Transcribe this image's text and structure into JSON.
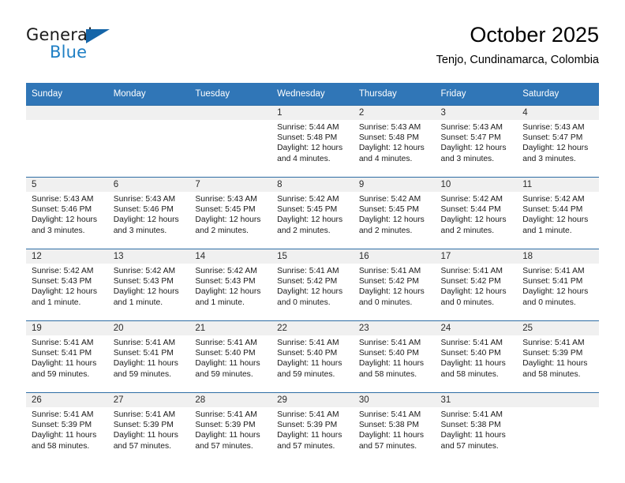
{
  "brand": {
    "word1": "General",
    "word2": "Blue",
    "triangle_color": "#1565a8",
    "blue_color": "#1f7fc4"
  },
  "header": {
    "title": "October 2025",
    "subtitle": "Tenjo, Cundinamarca, Colombia"
  },
  "theme": {
    "header_row_bg": "#3076b7",
    "cell_border": "#2e6da4",
    "day_band_bg": "#f0f0f0"
  },
  "weekday_headers": [
    "Sunday",
    "Monday",
    "Tuesday",
    "Wednesday",
    "Thursday",
    "Friday",
    "Saturday"
  ],
  "weeks": [
    [
      {
        "empty": true
      },
      {
        "empty": true
      },
      {
        "empty": true
      },
      {
        "day": "1",
        "sunrise": "Sunrise: 5:44 AM",
        "sunset": "Sunset: 5:48 PM",
        "daylight1": "Daylight: 12 hours",
        "daylight2": "and 4 minutes."
      },
      {
        "day": "2",
        "sunrise": "Sunrise: 5:43 AM",
        "sunset": "Sunset: 5:48 PM",
        "daylight1": "Daylight: 12 hours",
        "daylight2": "and 4 minutes."
      },
      {
        "day": "3",
        "sunrise": "Sunrise: 5:43 AM",
        "sunset": "Sunset: 5:47 PM",
        "daylight1": "Daylight: 12 hours",
        "daylight2": "and 3 minutes."
      },
      {
        "day": "4",
        "sunrise": "Sunrise: 5:43 AM",
        "sunset": "Sunset: 5:47 PM",
        "daylight1": "Daylight: 12 hours",
        "daylight2": "and 3 minutes."
      }
    ],
    [
      {
        "day": "5",
        "sunrise": "Sunrise: 5:43 AM",
        "sunset": "Sunset: 5:46 PM",
        "daylight1": "Daylight: 12 hours",
        "daylight2": "and 3 minutes."
      },
      {
        "day": "6",
        "sunrise": "Sunrise: 5:43 AM",
        "sunset": "Sunset: 5:46 PM",
        "daylight1": "Daylight: 12 hours",
        "daylight2": "and 3 minutes."
      },
      {
        "day": "7",
        "sunrise": "Sunrise: 5:43 AM",
        "sunset": "Sunset: 5:45 PM",
        "daylight1": "Daylight: 12 hours",
        "daylight2": "and 2 minutes."
      },
      {
        "day": "8",
        "sunrise": "Sunrise: 5:42 AM",
        "sunset": "Sunset: 5:45 PM",
        "daylight1": "Daylight: 12 hours",
        "daylight2": "and 2 minutes."
      },
      {
        "day": "9",
        "sunrise": "Sunrise: 5:42 AM",
        "sunset": "Sunset: 5:45 PM",
        "daylight1": "Daylight: 12 hours",
        "daylight2": "and 2 minutes."
      },
      {
        "day": "10",
        "sunrise": "Sunrise: 5:42 AM",
        "sunset": "Sunset: 5:44 PM",
        "daylight1": "Daylight: 12 hours",
        "daylight2": "and 2 minutes."
      },
      {
        "day": "11",
        "sunrise": "Sunrise: 5:42 AM",
        "sunset": "Sunset: 5:44 PM",
        "daylight1": "Daylight: 12 hours",
        "daylight2": "and 1 minute."
      }
    ],
    [
      {
        "day": "12",
        "sunrise": "Sunrise: 5:42 AM",
        "sunset": "Sunset: 5:43 PM",
        "daylight1": "Daylight: 12 hours",
        "daylight2": "and 1 minute."
      },
      {
        "day": "13",
        "sunrise": "Sunrise: 5:42 AM",
        "sunset": "Sunset: 5:43 PM",
        "daylight1": "Daylight: 12 hours",
        "daylight2": "and 1 minute."
      },
      {
        "day": "14",
        "sunrise": "Sunrise: 5:42 AM",
        "sunset": "Sunset: 5:43 PM",
        "daylight1": "Daylight: 12 hours",
        "daylight2": "and 1 minute."
      },
      {
        "day": "15",
        "sunrise": "Sunrise: 5:41 AM",
        "sunset": "Sunset: 5:42 PM",
        "daylight1": "Daylight: 12 hours",
        "daylight2": "and 0 minutes."
      },
      {
        "day": "16",
        "sunrise": "Sunrise: 5:41 AM",
        "sunset": "Sunset: 5:42 PM",
        "daylight1": "Daylight: 12 hours",
        "daylight2": "and 0 minutes."
      },
      {
        "day": "17",
        "sunrise": "Sunrise: 5:41 AM",
        "sunset": "Sunset: 5:42 PM",
        "daylight1": "Daylight: 12 hours",
        "daylight2": "and 0 minutes."
      },
      {
        "day": "18",
        "sunrise": "Sunrise: 5:41 AM",
        "sunset": "Sunset: 5:41 PM",
        "daylight1": "Daylight: 12 hours",
        "daylight2": "and 0 minutes."
      }
    ],
    [
      {
        "day": "19",
        "sunrise": "Sunrise: 5:41 AM",
        "sunset": "Sunset: 5:41 PM",
        "daylight1": "Daylight: 11 hours",
        "daylight2": "and 59 minutes."
      },
      {
        "day": "20",
        "sunrise": "Sunrise: 5:41 AM",
        "sunset": "Sunset: 5:41 PM",
        "daylight1": "Daylight: 11 hours",
        "daylight2": "and 59 minutes."
      },
      {
        "day": "21",
        "sunrise": "Sunrise: 5:41 AM",
        "sunset": "Sunset: 5:40 PM",
        "daylight1": "Daylight: 11 hours",
        "daylight2": "and 59 minutes."
      },
      {
        "day": "22",
        "sunrise": "Sunrise: 5:41 AM",
        "sunset": "Sunset: 5:40 PM",
        "daylight1": "Daylight: 11 hours",
        "daylight2": "and 59 minutes."
      },
      {
        "day": "23",
        "sunrise": "Sunrise: 5:41 AM",
        "sunset": "Sunset: 5:40 PM",
        "daylight1": "Daylight: 11 hours",
        "daylight2": "and 58 minutes."
      },
      {
        "day": "24",
        "sunrise": "Sunrise: 5:41 AM",
        "sunset": "Sunset: 5:40 PM",
        "daylight1": "Daylight: 11 hours",
        "daylight2": "and 58 minutes."
      },
      {
        "day": "25",
        "sunrise": "Sunrise: 5:41 AM",
        "sunset": "Sunset: 5:39 PM",
        "daylight1": "Daylight: 11 hours",
        "daylight2": "and 58 minutes."
      }
    ],
    [
      {
        "day": "26",
        "sunrise": "Sunrise: 5:41 AM",
        "sunset": "Sunset: 5:39 PM",
        "daylight1": "Daylight: 11 hours",
        "daylight2": "and 58 minutes."
      },
      {
        "day": "27",
        "sunrise": "Sunrise: 5:41 AM",
        "sunset": "Sunset: 5:39 PM",
        "daylight1": "Daylight: 11 hours",
        "daylight2": "and 57 minutes."
      },
      {
        "day": "28",
        "sunrise": "Sunrise: 5:41 AM",
        "sunset": "Sunset: 5:39 PM",
        "daylight1": "Daylight: 11 hours",
        "daylight2": "and 57 minutes."
      },
      {
        "day": "29",
        "sunrise": "Sunrise: 5:41 AM",
        "sunset": "Sunset: 5:39 PM",
        "daylight1": "Daylight: 11 hours",
        "daylight2": "and 57 minutes."
      },
      {
        "day": "30",
        "sunrise": "Sunrise: 5:41 AM",
        "sunset": "Sunset: 5:38 PM",
        "daylight1": "Daylight: 11 hours",
        "daylight2": "and 57 minutes."
      },
      {
        "day": "31",
        "sunrise": "Sunrise: 5:41 AM",
        "sunset": "Sunset: 5:38 PM",
        "daylight1": "Daylight: 11 hours",
        "daylight2": "and 57 minutes."
      },
      {
        "empty": true
      }
    ]
  ]
}
